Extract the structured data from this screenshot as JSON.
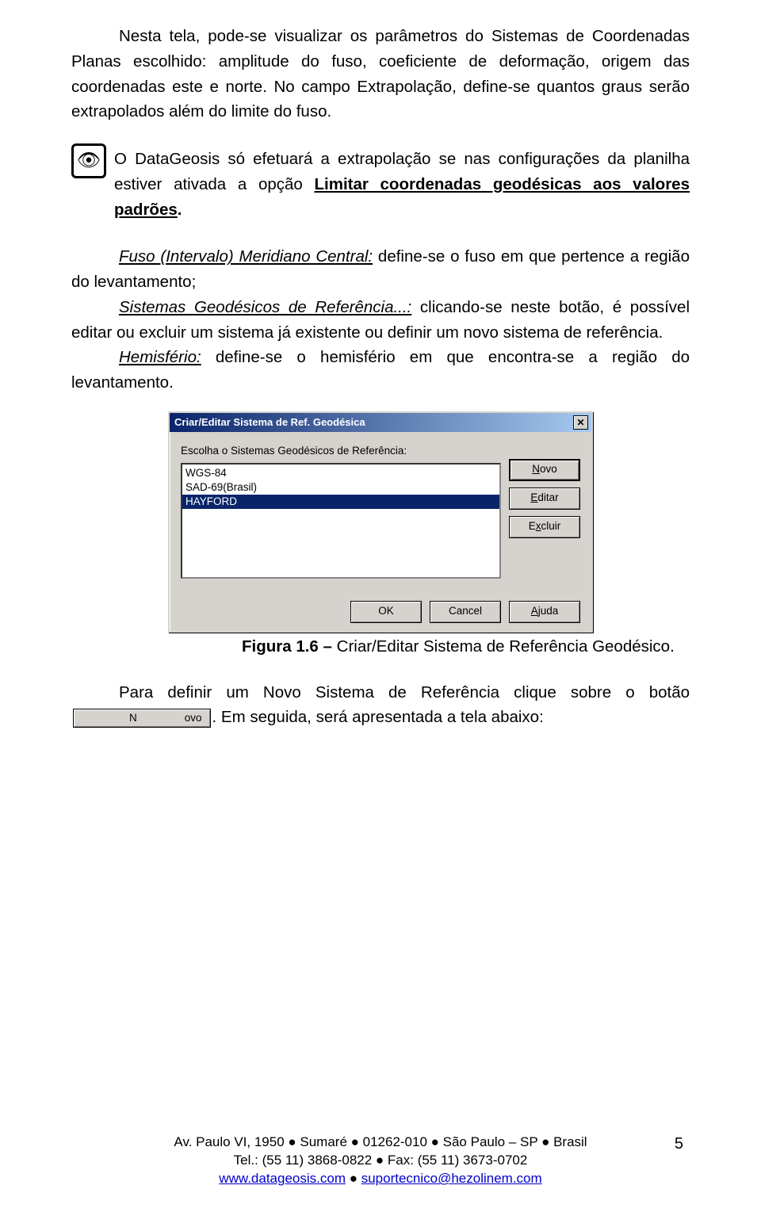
{
  "para1": "Nesta tela, pode-se visualizar os parâmetros do Sistemas de Coordenadas Planas escolhido: amplitude do fuso, coeficiente de deformação, origem das coordenadas este e norte. No campo Extrapolação, define-se quantos graus serão extrapolados além do limite do fuso.",
  "note": {
    "lead": "O DataGeosis só efetuará a extrapolação se nas configurações da planilha estiver ativada a opção ",
    "underlined": "Limitar coordenadas geodésicas aos valores padrões",
    "tail": "."
  },
  "fuso": {
    "label": "Fuso (Intervalo) Meridiano Central:",
    "text": " define-se o fuso em que pertence a região do levantamento;"
  },
  "sistemas": {
    "label": "Sistemas Geodésicos de Referência...:",
    "text": " clicando-se neste botão, é possível editar ou excluir um sistema já existente ou definir um novo sistema de referência."
  },
  "hemi": {
    "label": "Hemisfério:",
    "text": " define-se o hemisfério em que encontra-se a região do levantamento."
  },
  "dialog": {
    "title": "Criar/Editar Sistema de Ref. Geodésica",
    "prompt": "Escolha o Sistemas Geodésicos de Referência:",
    "items": [
      "WGS-84",
      "SAD-69(Brasil)",
      "HAYFORD"
    ],
    "selected_index": 2,
    "buttons": {
      "novo_pre": "",
      "novo_u": "N",
      "novo_post": "ovo",
      "editar_pre": "",
      "editar_u": "E",
      "editar_post": "ditar",
      "excluir_pre": "E",
      "excluir_u": "x",
      "excluir_post": "cluir",
      "ok": "OK",
      "cancel": "Cancel",
      "ajuda_pre": "",
      "ajuda_u": "A",
      "ajuda_post": "juda"
    }
  },
  "caption": {
    "bold": "Figura 1.6 – ",
    "rest": "Criar/Editar Sistema de Referência Geodésico."
  },
  "para_end": {
    "pre": "Para definir um Novo Sistema de Referência clique sobre o botão ",
    "btn_pre": "",
    "btn_u": "N",
    "btn_post": "ovo",
    "post": ". Em seguida, será apresentada a tela abaixo:"
  },
  "footer": {
    "line1": "Av. Paulo VI, 1950 ● Sumaré ● 01262-010 ● São Paulo – SP ● Brasil",
    "line2": "Tel.: (55 11) 3868-0822 ● Fax: (55 11) 3673-0702",
    "link1": "www.datageosis.com",
    "sep": " ● ",
    "link2": "suportecnico@hezolinem.com"
  },
  "page_number": "5"
}
